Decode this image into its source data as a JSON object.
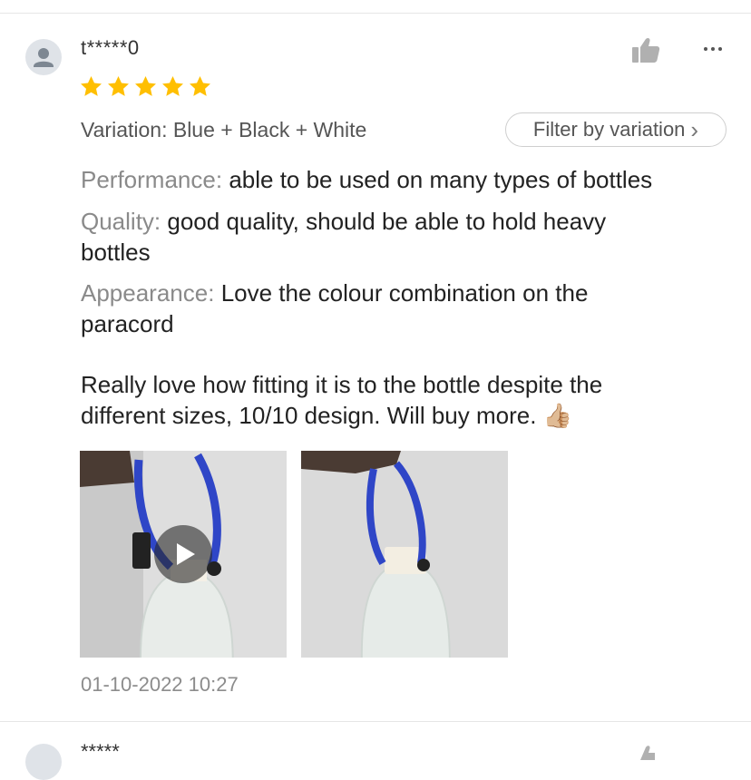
{
  "review": {
    "username": "t*****0",
    "rating": 5,
    "max_rating": 5,
    "variation_text": "Variation: Blue + Black + White",
    "filter_button_label": "Filter by variation",
    "filter_chevron": "›",
    "performance_label": "Performance:",
    "performance_text": "able to be used on many types of bottles",
    "quality_label": "Quality:",
    "quality_text": "good quality, should be able to hold heavy bottles",
    "appearance_label": "Appearance:",
    "appearance_text": "Love the colour combination on the paracord",
    "comment": "Really love how fitting it is to the bottle despite the different sizes, 10/10 design. Will buy more. 👍🏼",
    "media": [
      {
        "type": "video",
        "alt": "paracord bottle holder video"
      },
      {
        "type": "image",
        "alt": "paracord bottle holder photo"
      }
    ],
    "timestamp": "01-10-2022 10:27"
  },
  "next_review": {
    "username": "*****"
  },
  "icons": {
    "like": "thumbs-up-icon",
    "more": "more-dots-icon",
    "avatar": "user-avatar-icon",
    "play": "play-icon",
    "star": "star-icon"
  },
  "colors": {
    "star": "#ffbf00",
    "label_gray": "#8a8a8a",
    "text": "#222222",
    "border": "#cfcfcf",
    "icon_gray": "#b0b0b0"
  }
}
